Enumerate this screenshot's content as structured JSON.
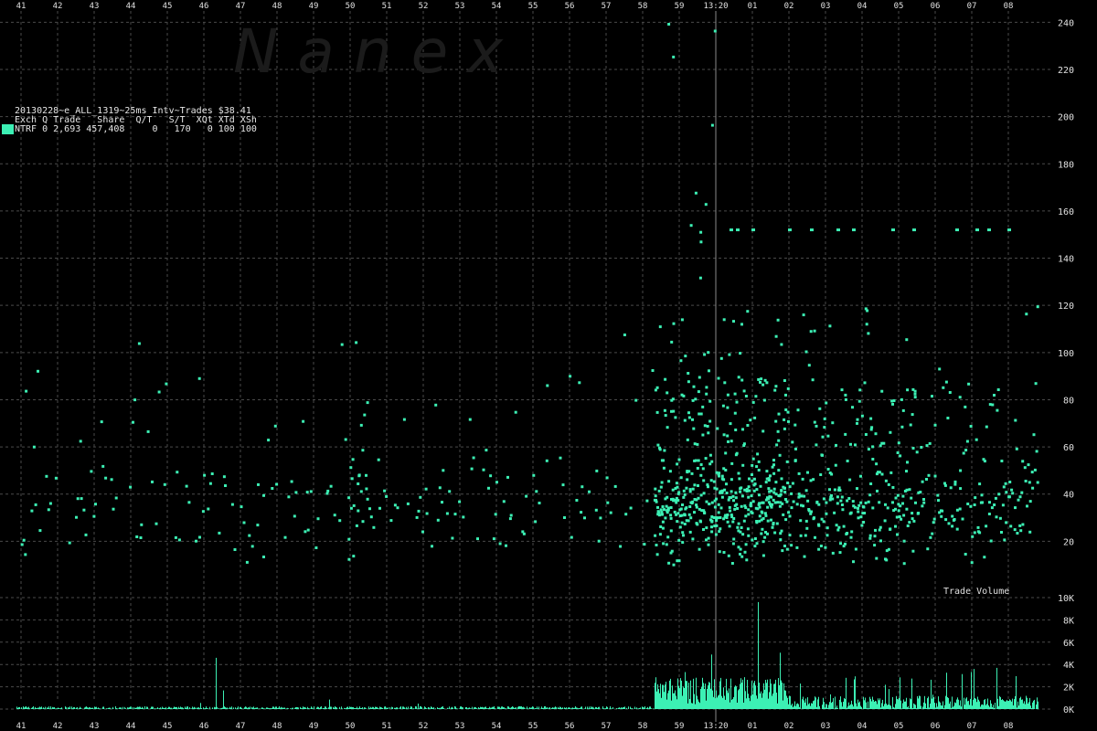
{
  "header": {
    "title": "20130228~e_ALL_1319~25ms Intv~Trades $38.41",
    "columns": "Exch Q Trade   Share  Q/T   S/T  XQt XTd XSh",
    "legend_row": "NTRF 0 2,693 457,408     0   170   0 100 100"
  },
  "watermark": "N  a  n  e  x",
  "colors": {
    "accent": "#3cf0b4",
    "grid": "#4a4a4a",
    "background": "#000000",
    "center_line": "#8a8a8a"
  },
  "chart_data": [
    {
      "type": "scatter",
      "title": "",
      "x_ticks_top": [
        "41",
        "42",
        "43",
        "44",
        "45",
        "46",
        "47",
        "48",
        "49",
        "50",
        "51",
        "52",
        "53",
        "54",
        "55",
        "56",
        "57",
        "58",
        "59",
        "13:20",
        "01",
        "02",
        "03",
        "04",
        "05",
        "06",
        "07",
        "08"
      ],
      "y_ticks": [
        "20",
        "40",
        "60",
        "80",
        "100",
        "120",
        "140",
        "160",
        "180",
        "200",
        "220",
        "240"
      ],
      "ylim": [
        0,
        240
      ],
      "series": [
        {
          "x_clusters": "dense trade activity between 58 and 08",
          "points_sample": 1800
        }
      ]
    },
    {
      "type": "bar",
      "title": "Trade Volume",
      "y_ticks": [
        "0K",
        "2K",
        "4K",
        "6K",
        "8K",
        "10K"
      ],
      "ylim": [
        0,
        10000
      ],
      "x_ticks_bottom": [
        "41",
        "42",
        "43",
        "44",
        "45",
        "46",
        "47",
        "48",
        "49",
        "50",
        "51",
        "52",
        "53",
        "54",
        "55",
        "56",
        "57",
        "58",
        "59",
        "13:20",
        "01",
        "02",
        "03",
        "04",
        "05",
        "06",
        "07",
        "08"
      ]
    }
  ]
}
